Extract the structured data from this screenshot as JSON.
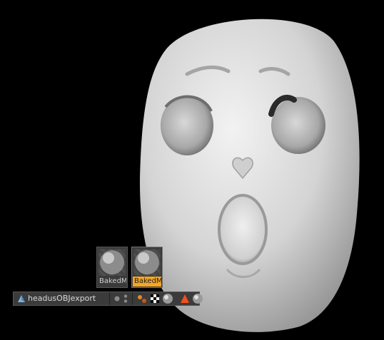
{
  "scene": {
    "object_name": "headusOBJexport",
    "background_color": "#000000",
    "model_color": "#d9d9d9"
  },
  "materials": [
    {
      "name": "BakedM",
      "selected": false
    },
    {
      "name": "BakedM",
      "selected": true
    }
  ],
  "object_tags": [
    "phong-tag-icon",
    "uvw-tag-icon",
    "material-tag-icon",
    "warning-tag-icon",
    "material-tag-icon"
  ],
  "accent_color": "#f5a623"
}
